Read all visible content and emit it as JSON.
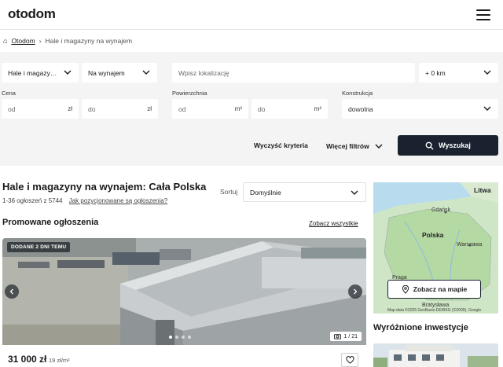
{
  "header": {
    "logo": "otodom",
    "menu_icon": "hamburger-menu-icon"
  },
  "breadcrumb": {
    "home": "Otodom",
    "separator": "›",
    "current": "Hale i magazyny na wynajem"
  },
  "filters": {
    "category": "Hale i magazy…",
    "transaction": "Na wynajem",
    "location_placeholder": "Wpisz lokalizację",
    "distance": "+ 0 km",
    "price_label": "Cena",
    "price_from": "od",
    "price_to": "do",
    "price_unit": "zł",
    "area_label": "Powierzchnia",
    "area_from": "od",
    "area_to": "do",
    "area_unit": "m²",
    "construction_label": "Konstrukcja",
    "construction_value": "dowolna",
    "clear_label": "Wyczyść kryteria",
    "more_label": "Więcej filtrów",
    "search_label": "Wyszukaj"
  },
  "results": {
    "title": "Hale i magazyny na wynajem: Cała Polska",
    "count": "1-36 ogłoszeń z 5744",
    "positioning_link": "Jak pozycjonowane są ogłoszenia?",
    "sort_label": "Sortuj",
    "sort_value": "Domyślnie"
  },
  "promoted": {
    "title": "Promowane ogłoszenia",
    "see_all": "Zobacz wszystkie",
    "listing": {
      "badge": "DODANE 2 DNI TEMU",
      "photo_counter": "1 / 21",
      "price": "31 000 zł",
      "price_per_m": "19 zł/m²"
    }
  },
  "map": {
    "labels": {
      "litwa": "Litwa",
      "gdansk": "Gdańsk",
      "polska": "Polska",
      "warszawa": "Warszawa",
      "praga": "Praga",
      "bratyslawa": "Bratysława"
    },
    "button": "Zobacz na mapie",
    "attribution": "Map data ©2025 GeoBasis-DE/BKG (©2009), Google"
  },
  "featured": {
    "title": "Wyróżnione inwestycje"
  },
  "colors": {
    "primary_dark": "#1a2230",
    "filter_bg": "#f4f4f4"
  }
}
